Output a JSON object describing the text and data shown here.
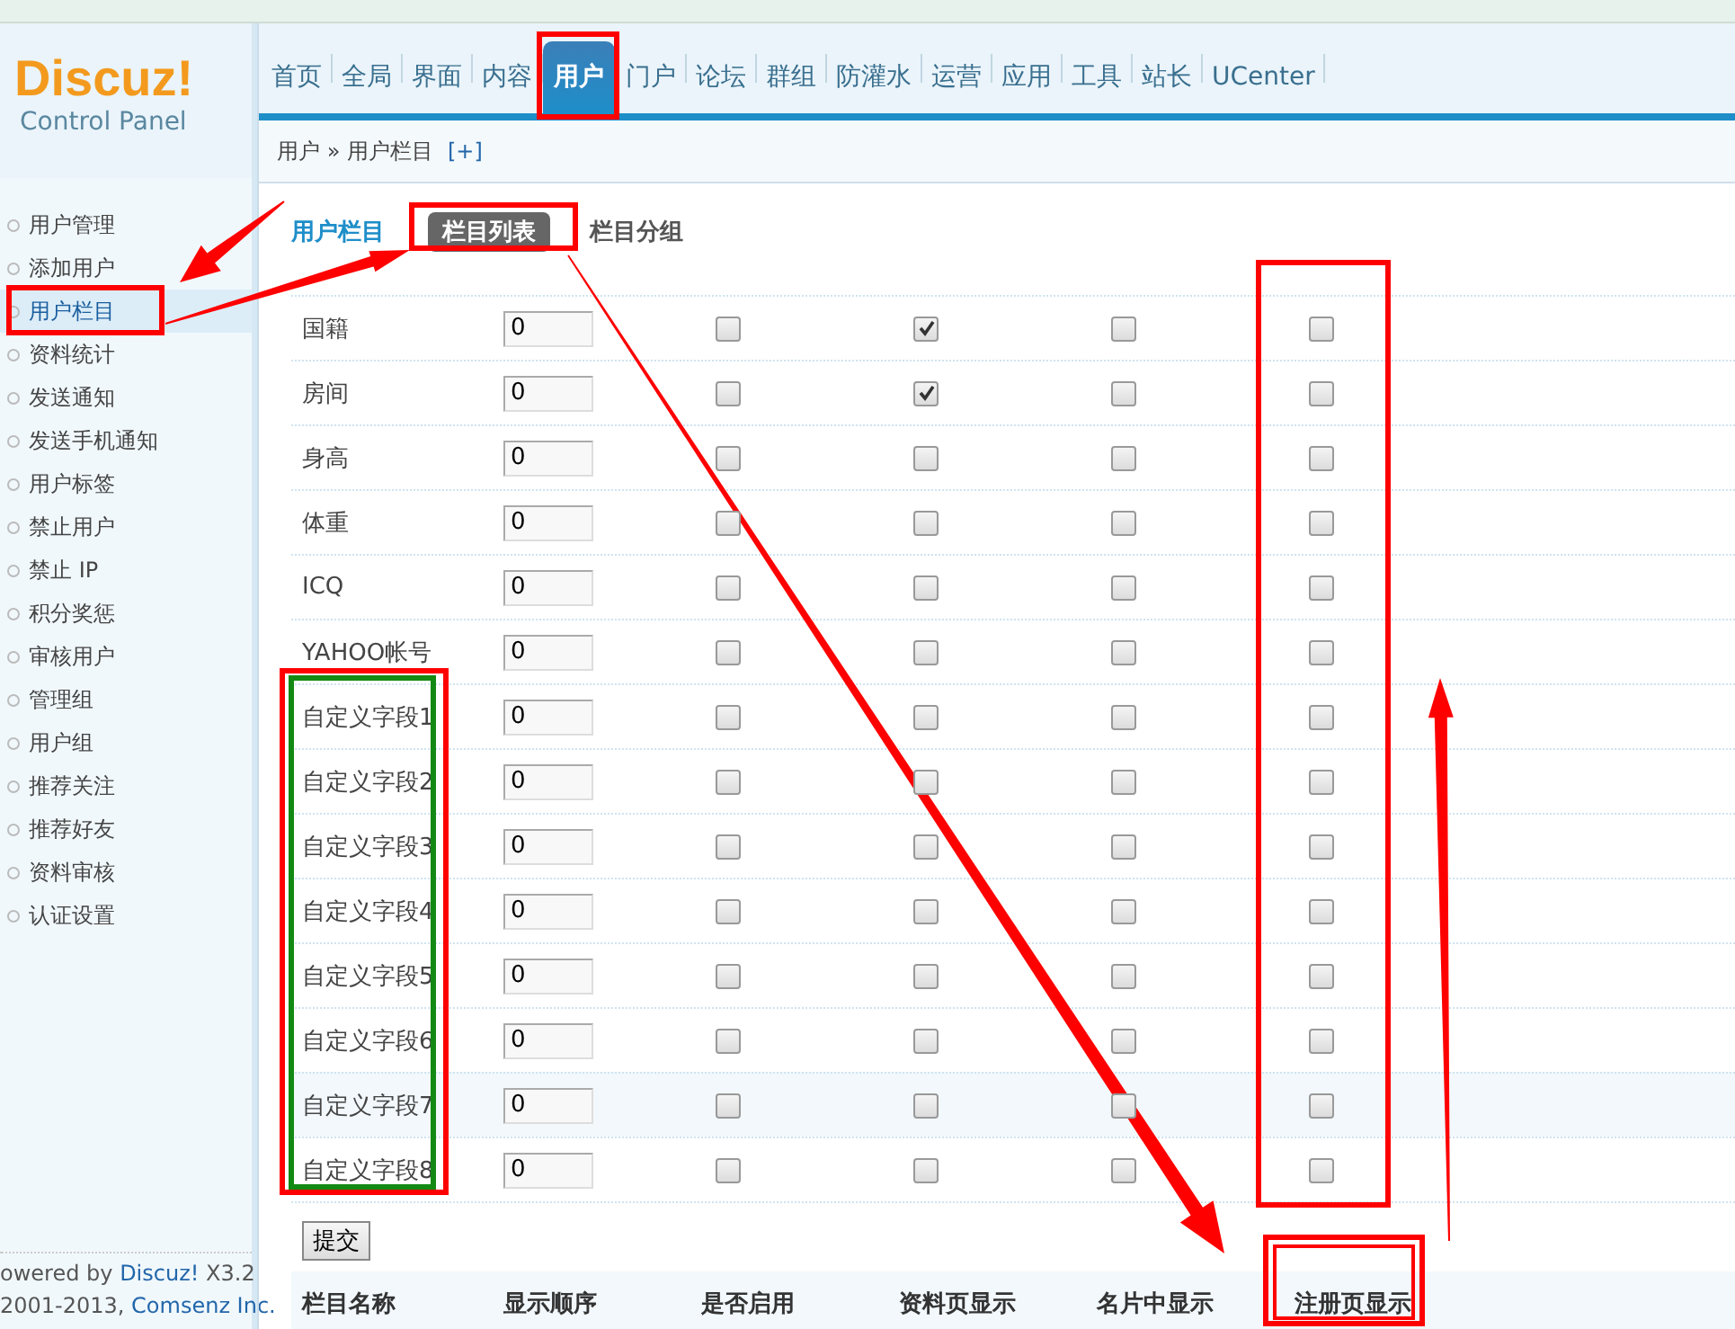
{
  "logo": {
    "title": "Discuz!",
    "subtitle": "Control Panel"
  },
  "nav": [
    {
      "label": "首页",
      "selected": false
    },
    {
      "label": "全局",
      "selected": false
    },
    {
      "label": "界面",
      "selected": false
    },
    {
      "label": "内容",
      "selected": false
    },
    {
      "label": "用户",
      "selected": true
    },
    {
      "label": "门户",
      "selected": false
    },
    {
      "label": "论坛",
      "selected": false
    },
    {
      "label": "群组",
      "selected": false
    },
    {
      "label": "防灌水",
      "selected": false
    },
    {
      "label": "运营",
      "selected": false
    },
    {
      "label": "应用",
      "selected": false
    },
    {
      "label": "工具",
      "selected": false
    },
    {
      "label": "站长",
      "selected": false
    },
    {
      "label": "UCenter",
      "selected": false
    }
  ],
  "breadcrumb": {
    "text": "用户 » 用户栏目",
    "add": "[+]"
  },
  "sidebar": [
    {
      "label": "用户管理",
      "selected": false
    },
    {
      "label": "添加用户",
      "selected": false
    },
    {
      "label": "用户栏目",
      "selected": true
    },
    {
      "label": "资料统计",
      "selected": false
    },
    {
      "label": "发送通知",
      "selected": false
    },
    {
      "label": "发送手机通知",
      "selected": false
    },
    {
      "label": "用户标签",
      "selected": false
    },
    {
      "label": "禁止用户",
      "selected": false
    },
    {
      "label": "禁止 IP",
      "selected": false
    },
    {
      "label": "积分奖惩",
      "selected": false
    },
    {
      "label": "审核用户",
      "selected": false
    },
    {
      "label": "管理组",
      "selected": false
    },
    {
      "label": "用户组",
      "selected": false
    },
    {
      "label": "推荐关注",
      "selected": false
    },
    {
      "label": "推荐好友",
      "selected": false
    },
    {
      "label": "资料审核",
      "selected": false
    },
    {
      "label": "认证设置",
      "selected": false
    }
  ],
  "footer": [
    {
      "text": "owered by ",
      "link": "Discuz!",
      "after": " X3.2"
    },
    {
      "text": "2001-2013, ",
      "link": "Comsenz Inc."
    }
  ],
  "page_title": "用户栏目",
  "subtabs": [
    {
      "label": "栏目列表",
      "selected": true
    },
    {
      "label": "栏目分组",
      "selected": false
    }
  ],
  "rows": [
    {
      "name": "国籍",
      "order": "0",
      "enabled": false,
      "profile": true,
      "card": false,
      "register": false,
      "highlighted": false
    },
    {
      "name": "房间",
      "order": "0",
      "enabled": false,
      "profile": true,
      "card": false,
      "register": false,
      "highlighted": false
    },
    {
      "name": "身高",
      "order": "0",
      "enabled": false,
      "profile": false,
      "card": false,
      "register": false,
      "highlighted": false
    },
    {
      "name": "体重",
      "order": "0",
      "enabled": false,
      "profile": false,
      "card": false,
      "register": false,
      "highlighted": false
    },
    {
      "name": "ICQ",
      "order": "0",
      "enabled": false,
      "profile": false,
      "card": false,
      "register": false,
      "highlighted": false
    },
    {
      "name": "YAHOO帐号",
      "order": "0",
      "enabled": false,
      "profile": false,
      "card": false,
      "register": false,
      "highlighted": false
    },
    {
      "name": "自定义字段1",
      "order": "0",
      "enabled": false,
      "profile": false,
      "card": false,
      "register": false,
      "highlighted": false
    },
    {
      "name": "自定义字段2",
      "order": "0",
      "enabled": false,
      "profile": false,
      "card": false,
      "register": false,
      "highlighted": false
    },
    {
      "name": "自定义字段3",
      "order": "0",
      "enabled": false,
      "profile": false,
      "card": false,
      "register": false,
      "highlighted": false
    },
    {
      "name": "自定义字段4",
      "order": "0",
      "enabled": false,
      "profile": false,
      "card": false,
      "register": false,
      "highlighted": false
    },
    {
      "name": "自定义字段5",
      "order": "0",
      "enabled": false,
      "profile": false,
      "card": false,
      "register": false,
      "highlighted": false
    },
    {
      "name": "自定义字段6",
      "order": "0",
      "enabled": false,
      "profile": false,
      "card": false,
      "register": false,
      "highlighted": false
    },
    {
      "name": "自定义字段7",
      "order": "0",
      "enabled": false,
      "profile": false,
      "card": false,
      "register": false,
      "highlighted": true
    },
    {
      "name": "自定义字段8",
      "order": "0",
      "enabled": false,
      "profile": false,
      "card": false,
      "register": false,
      "highlighted": false
    }
  ],
  "submit": "提交",
  "columns": [
    "栏目名称",
    "显示顺序",
    "是否启用",
    "资料页显示",
    "名片中显示",
    "注册页显示"
  ]
}
